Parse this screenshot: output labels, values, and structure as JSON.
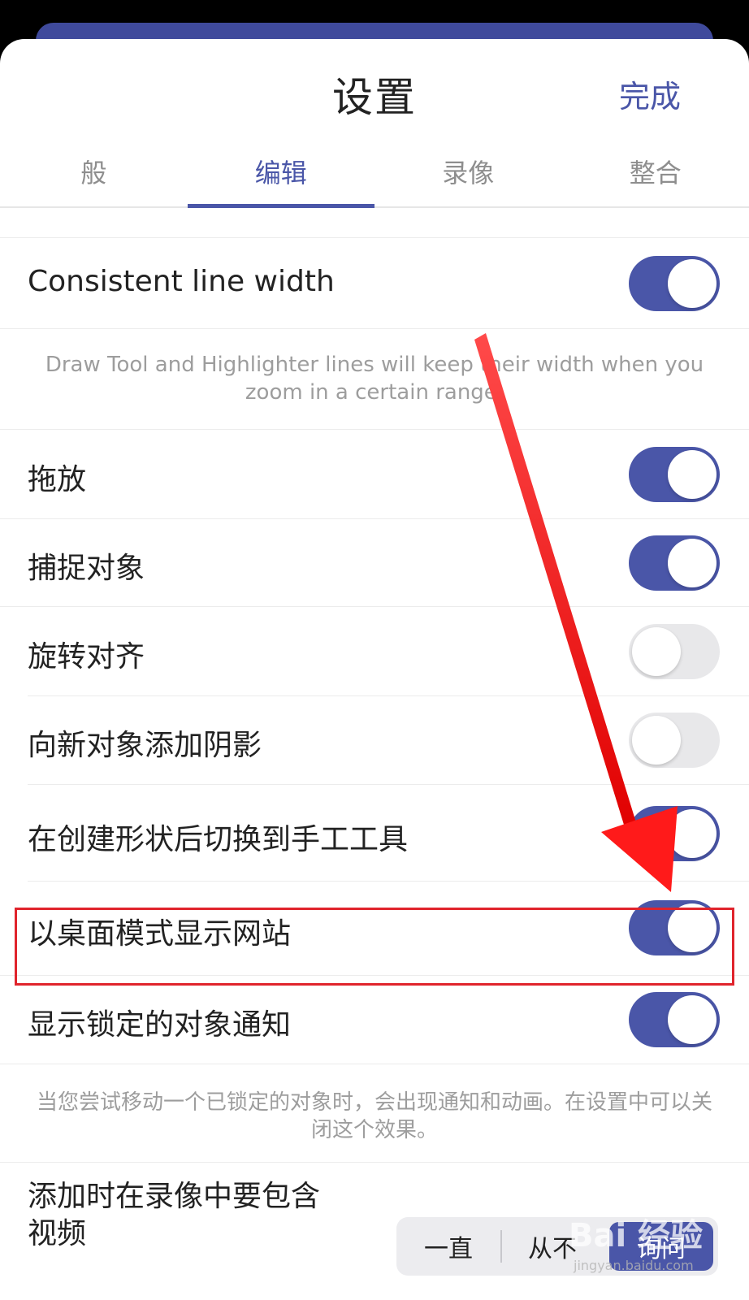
{
  "header": {
    "title": "设置",
    "done_label": "完成"
  },
  "tabs": [
    {
      "label": "般"
    },
    {
      "label": "编辑"
    },
    {
      "label": "录像"
    },
    {
      "label": "整合"
    }
  ],
  "settings": {
    "consistent_line_width": {
      "label": "Consistent line width",
      "on": true
    },
    "consistent_line_width_desc": "Draw Tool and Highlighter lines will keep their width when you zoom in a certain range.",
    "drag_drop": {
      "label": "拖放",
      "on": true
    },
    "snap_objects": {
      "label": "捕捉对象",
      "on": true
    },
    "rotate_align": {
      "label": "旋转对齐",
      "on": false
    },
    "shadow_new_objects": {
      "label": "向新对象添加阴影",
      "on": false
    },
    "switch_hand_tool": {
      "label": "在创建形状后切换到手工工具",
      "on": true
    },
    "desktop_mode": {
      "label": "以桌面模式显示网站",
      "on": true
    },
    "locked_notifications": {
      "label": "显示锁定的对象通知",
      "on": true
    },
    "locked_notifications_desc": "当您尝试移动一个已锁定的对象时，会出现通知和动画。在设置中可以关闭这个效果。",
    "include_video": {
      "label_line1": "添加时在录像中要包含",
      "label_line2": "视频",
      "options": [
        "一直",
        "从不",
        "询问"
      ],
      "selected": "询问"
    }
  },
  "watermark": {
    "text": "Bai 经验",
    "sub": "jingyan.baidu.com"
  },
  "colors": {
    "accent": "#4a56a8",
    "highlight_border": "#e0242c",
    "arrow": "#ff1a1a"
  }
}
